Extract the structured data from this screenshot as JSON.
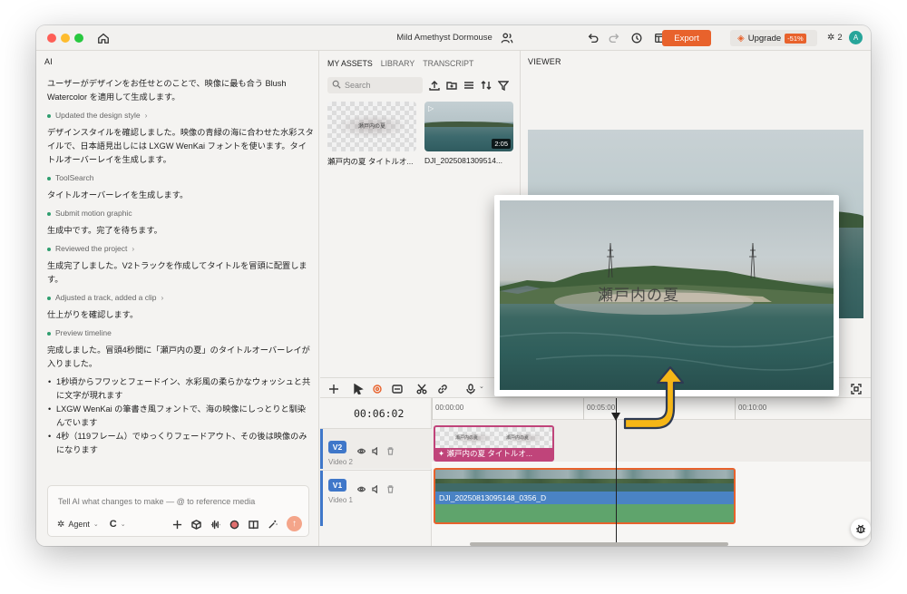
{
  "window": {
    "title": "Mild Amethyst Dormouse",
    "export_label": "Export",
    "upgrade_label": "Upgrade",
    "discount_label": "-51%",
    "credits": "2",
    "avatar_letter": "A",
    "accent_color": "#e8622c"
  },
  "ai_panel": {
    "label": "AI",
    "messages": [
      {
        "type": "text",
        "text": "ユーザーがデザインをお任せとのことで、映像に最も合う Blush Watercolor を適用して生成します。"
      },
      {
        "type": "step",
        "text": "Updated the design style",
        "expandable": true
      },
      {
        "type": "text",
        "text": "デザインスタイルを確認しました。映像の青緑の海に合わせた水彩スタイルで、日本語見出しには LXGW WenKai フォントを使います。タイトルオーバーレイを生成します。"
      },
      {
        "type": "step",
        "text": "ToolSearch",
        "expandable": false
      },
      {
        "type": "text",
        "text": "タイトルオーバーレイを生成します。"
      },
      {
        "type": "step",
        "text": "Submit motion graphic",
        "expandable": false
      },
      {
        "type": "text",
        "text": "生成中です。完了を待ちます。"
      },
      {
        "type": "step",
        "text": "Reviewed the project",
        "expandable": true
      },
      {
        "type": "text",
        "text": "生成完了しました。V2トラックを作成してタイトルを冒頭に配置します。"
      },
      {
        "type": "step",
        "text": "Adjusted a track, added a clip",
        "expandable": true
      },
      {
        "type": "text",
        "text": "仕上がりを確認します。"
      },
      {
        "type": "step",
        "text": "Preview timeline",
        "expandable": false
      },
      {
        "type": "text",
        "text": "完成しました。冒頭4秒間に「瀬戸内の夏」のタイトルオーバーレイが入りました。"
      }
    ],
    "bullets": [
      "1秒頃からフワッとフェードイン、水彩風の柔らかなウォッシュと共に文字が現れます",
      "LXGW WenKai の筆書き風フォントで、海の映像にしっとりと馴染んでいます",
      "4秒（119フレーム）でゆっくりフェードアウト、その後は映像のみになります"
    ],
    "input_placeholder": "Tell AI what changes to make — @ to reference media",
    "agent_label": "Agent"
  },
  "assets_panel": {
    "tabs": [
      "MY ASSETS",
      "LIBRARY",
      "TRANSCRIPT"
    ],
    "active_tab": "MY ASSETS",
    "search_placeholder": "Search",
    "assets": [
      {
        "name": "瀬戸内の夏 タイトルオ...",
        "thumb_text": "瀬戸内の夏",
        "duration": ""
      },
      {
        "name": "DJI_2025081309514...",
        "thumb_text": "",
        "duration": "2:05"
      }
    ]
  },
  "viewer": {
    "label": "VIEWER",
    "overlay_title": "瀬戸内の夏"
  },
  "timeline": {
    "timecode": "00:06:02",
    "ruler_marks": [
      "00:00:00",
      "00:05:00",
      "00:10:00"
    ],
    "tracks": [
      {
        "badge": "V2",
        "sub": "Video 2",
        "clip_label": "✦ 瀬戸内の夏 タイトルオ...",
        "clip_thumb_text": "瀬戸内の夏"
      },
      {
        "badge": "V1",
        "sub": "Video 1",
        "clip_label": "DJI_20250813095148_0356_D"
      }
    ]
  }
}
